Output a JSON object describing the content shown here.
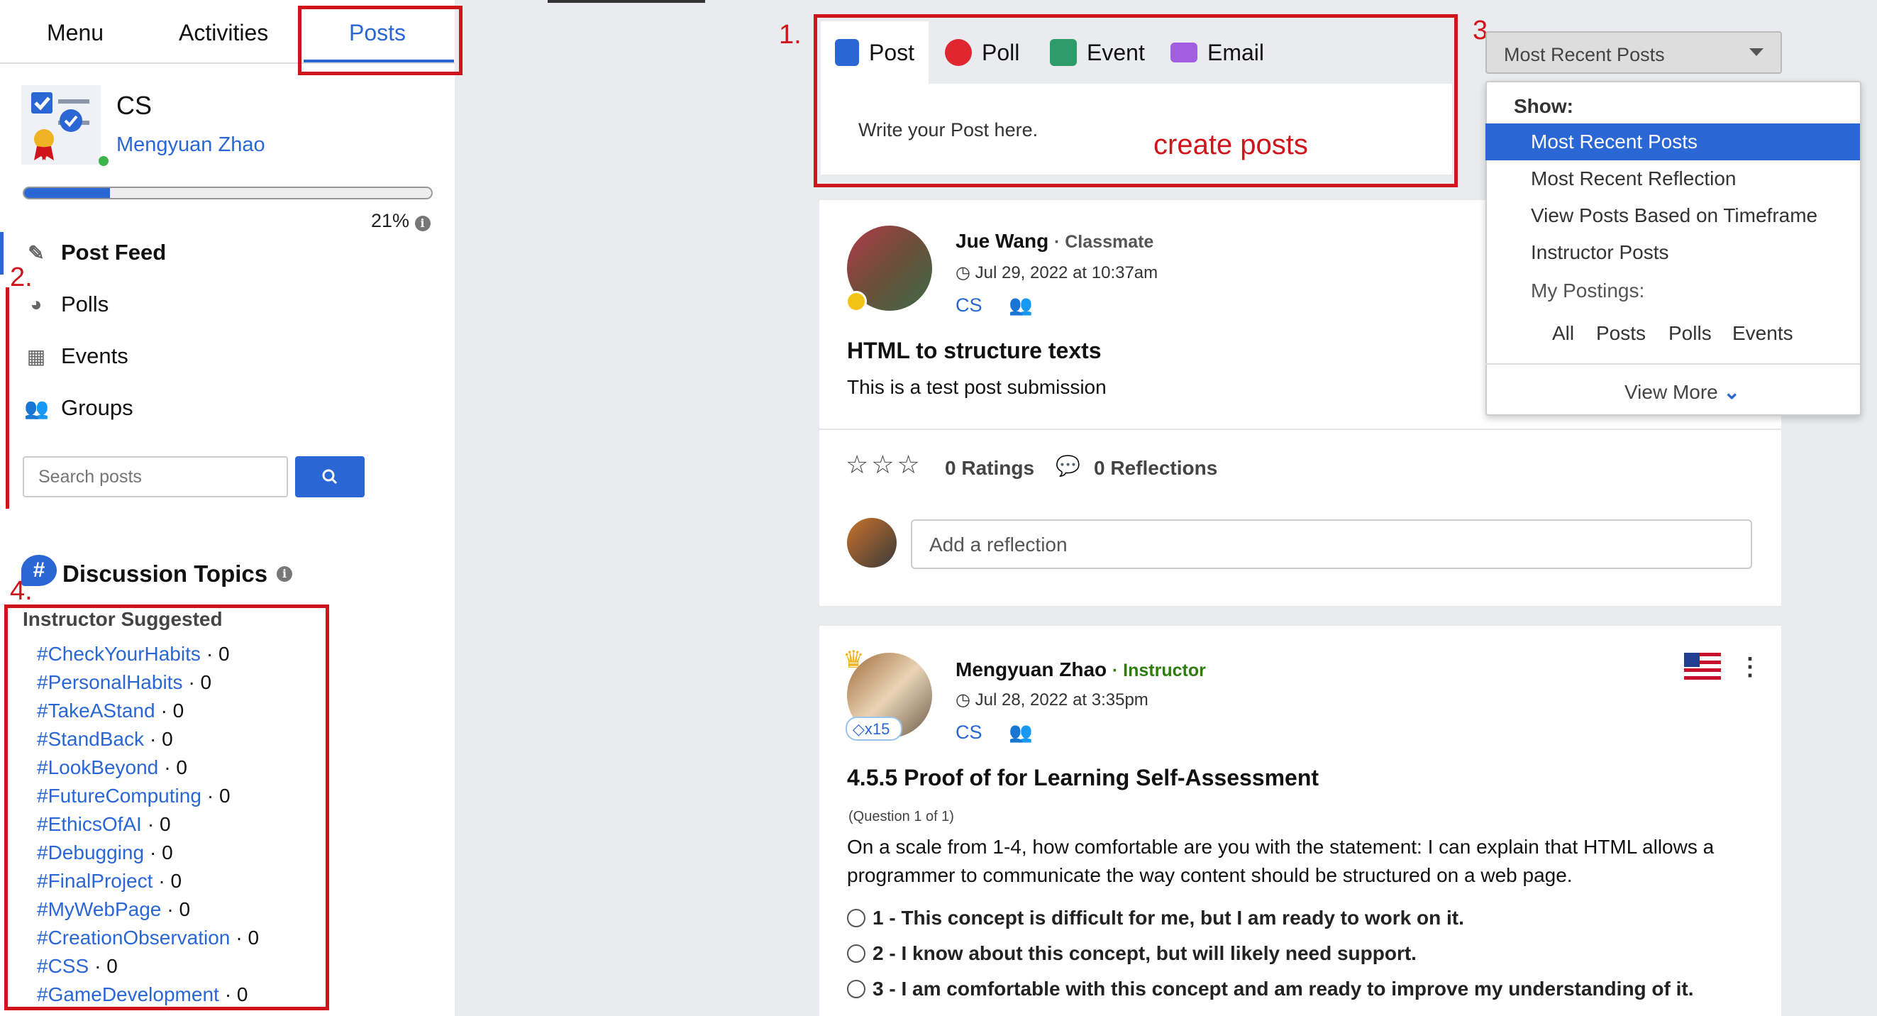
{
  "sidebar": {
    "tabs": [
      "Menu",
      "Activities",
      "Posts"
    ],
    "course": {
      "name": "CS",
      "user": "Mengyuan Zhao",
      "progress_pct": 21,
      "progress_label": "21%"
    },
    "nav": [
      "Post Feed",
      "Polls",
      "Events",
      "Groups"
    ],
    "search": {
      "placeholder": "Search posts"
    },
    "discussion": {
      "title": "Discussion Topics",
      "section": "Instructor Suggested",
      "topics": [
        {
          "tag": "#CheckYourHabits",
          "count": "· 0"
        },
        {
          "tag": "#PersonalHabits",
          "count": "· 0"
        },
        {
          "tag": "#TakeAStand",
          "count": "· 0"
        },
        {
          "tag": "#StandBack",
          "count": "· 0"
        },
        {
          "tag": "#LookBeyond",
          "count": "· 0"
        },
        {
          "tag": "#FutureComputing",
          "count": "· 0"
        },
        {
          "tag": "#EthicsOfAI",
          "count": "· 0"
        },
        {
          "tag": "#Debugging",
          "count": "· 0"
        },
        {
          "tag": "#FinalProject",
          "count": "· 0"
        },
        {
          "tag": "#MyWebPage",
          "count": "· 0"
        },
        {
          "tag": "#CreationObservation",
          "count": "· 0"
        },
        {
          "tag": "#CSS",
          "count": "· 0"
        },
        {
          "tag": "#GameDevelopment",
          "count": "· 0"
        }
      ]
    }
  },
  "annotations": {
    "n1": "1.",
    "n2": "2.",
    "n3": "3.",
    "n4": "4.",
    "create_posts": "create posts"
  },
  "creator": {
    "tabs": [
      "Post",
      "Poll",
      "Event",
      "Email"
    ],
    "placeholder": "Write your Post here."
  },
  "sort": {
    "selected": "Most Recent Posts",
    "show_label": "Show:",
    "options": [
      "Most Recent Posts",
      "Most Recent Reflection",
      "View Posts Based on Timeframe",
      "Instructor Posts"
    ],
    "my_postings": "My Postings:",
    "sub_options": [
      "All",
      "Posts",
      "Polls",
      "Events"
    ],
    "view_more": "View More"
  },
  "posts": [
    {
      "author": "Jue Wang",
      "role": "· Classmate",
      "timestamp": "Jul 29, 2022 at 10:37am",
      "course": "CS",
      "title": "HTML to structure texts",
      "body": "This is a test post submission",
      "ratings": "0 Ratings",
      "reflections": "0 Reflections",
      "reflect_placeholder": "Add a reflection"
    },
    {
      "author": "Mengyuan Zhao",
      "role": "· Instructor",
      "badge": "x15",
      "timestamp": "Jul 28, 2022 at 3:35pm",
      "course": "CS",
      "title": "4.5.5 Proof of for Learning Self-Assessment",
      "question_counter": "(Question 1 of 1)",
      "question": "On a scale from 1-4, how comfortable are you with the statement: I can explain that HTML allows a programmer to communicate the way content should be structured on a web page.",
      "options": [
        "1 - This concept is difficult for me, but I am ready to work on it.",
        "2 - I know about this concept, but will likely need support.",
        "3 - I am comfortable with this concept and am ready to improve my understanding of it."
      ]
    }
  ],
  "colors": {
    "accent": "#2a67d4",
    "annotation_red": "#d0141c",
    "instructor_green": "#2e7d0e"
  }
}
